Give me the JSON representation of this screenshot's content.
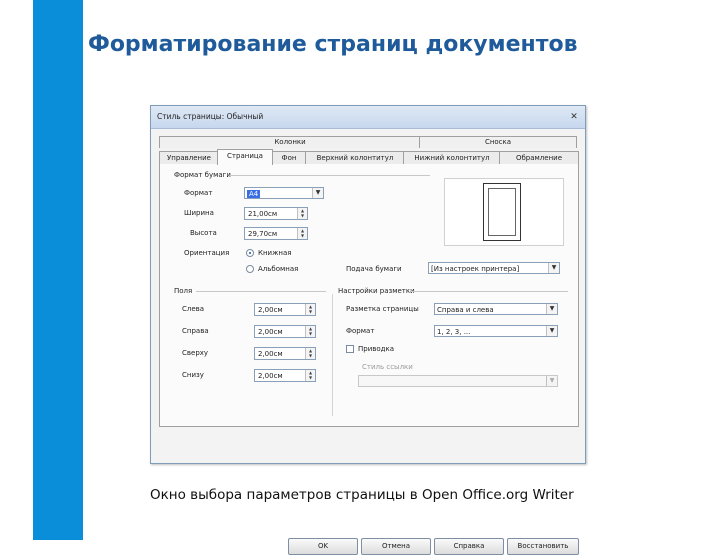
{
  "slide": {
    "title": "Форматирование страниц документов",
    "caption": "Окно выбора параметров страницы в Open Office.org Writer",
    "accent_color": "#0a8ed9",
    "title_color": "#1f5b9a"
  },
  "dialog": {
    "title": "Стиль страницы: Обычный",
    "close_icon": "close-icon",
    "tabs_top": [
      "Колонки",
      "Сноска"
    ],
    "tabs": [
      "Управление",
      "Страница",
      "Фон",
      "Верхний колонтитул",
      "Нижний колонтитул",
      "Обрамление"
    ],
    "active_tab": "Страница",
    "paper": {
      "group_label": "Формат бумаги",
      "format_label": "Формат",
      "format_value": "A4",
      "width_label": "Ширина",
      "width_value": "21,00см",
      "height_label": "Высота",
      "height_value": "29,70см",
      "orientation_label": "Ориентация",
      "portrait_label": "Книжная",
      "landscape_label": "Альбомная",
      "orientation_selected": "Книжная",
      "tray_label": "Подача бумаги",
      "tray_value": "[Из настроек принтера]"
    },
    "margins": {
      "group_label": "Поля",
      "left_label": "Слева",
      "left_value": "2,00см",
      "right_label": "Справа",
      "right_value": "2,00см",
      "top_label": "Сверху",
      "top_value": "2,00см",
      "bottom_label": "Снизу",
      "bottom_value": "2,00см"
    },
    "layout": {
      "group_label": "Настройки разметки",
      "layout_label": "Разметка страницы",
      "layout_value": "Справа и слева",
      "format_label": "Формат",
      "format_value": "1, 2, 3, ...",
      "register_label": "Приводка",
      "register_checked": false,
      "ref_style_label": "Стиль ссылки",
      "ref_style_value": ""
    },
    "buttons": {
      "ok": "OK",
      "cancel": "Отмена",
      "help": "Справка",
      "reset": "Восстановить"
    }
  }
}
